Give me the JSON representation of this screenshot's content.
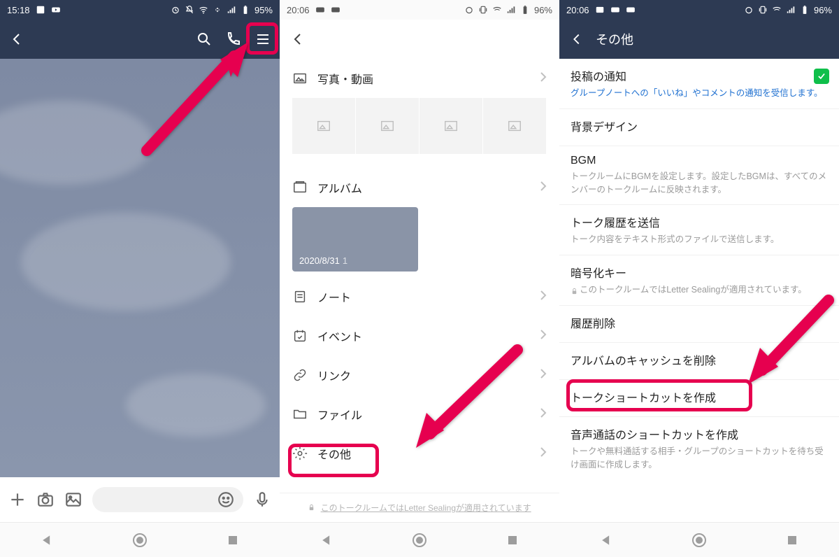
{
  "p1": {
    "status": {
      "time": "15:18",
      "battery": "95%"
    },
    "input_placeholder": ""
  },
  "p2": {
    "status": {
      "time": "20:06",
      "battery": "96%"
    },
    "sections": {
      "photos": "写真・動画",
      "album": "アルバム",
      "note": "ノート",
      "event": "イベント",
      "link": "リンク",
      "file": "ファイル",
      "other": "その他"
    },
    "album": {
      "date": "2020/8/31",
      "count": "1"
    },
    "footer": "このトークルームではLetter Sealingが適用されています"
  },
  "p3": {
    "status": {
      "time": "20:06",
      "battery": "96%"
    },
    "header_title": "その他",
    "items": {
      "notify_title": "投稿の通知",
      "notify_sub": "グループノートへの「いいね」やコメントの通知を受信します。",
      "bg_title": "背景デザイン",
      "bgm_title": "BGM",
      "bgm_sub": "トークルームにBGMを設定します。設定したBGMは、すべてのメンバーのトークルームに反映されます。",
      "history_send_title": "トーク履歴を送信",
      "history_send_sub": "トーク内容をテキスト形式のファイルで送信します。",
      "enc_title": "暗号化キー",
      "enc_sub": "このトークルームではLetter Sealingが適用されています。",
      "history_del_title": "履歴削除",
      "cache_title": "アルバムのキャッシュを削除",
      "shortcut_title": "トークショートカットを作成",
      "voice_title": "音声通話のショートカットを作成",
      "voice_sub": "トークや無料通話する相手・グループのショートカットを待ち受け画面に作成します。"
    }
  }
}
